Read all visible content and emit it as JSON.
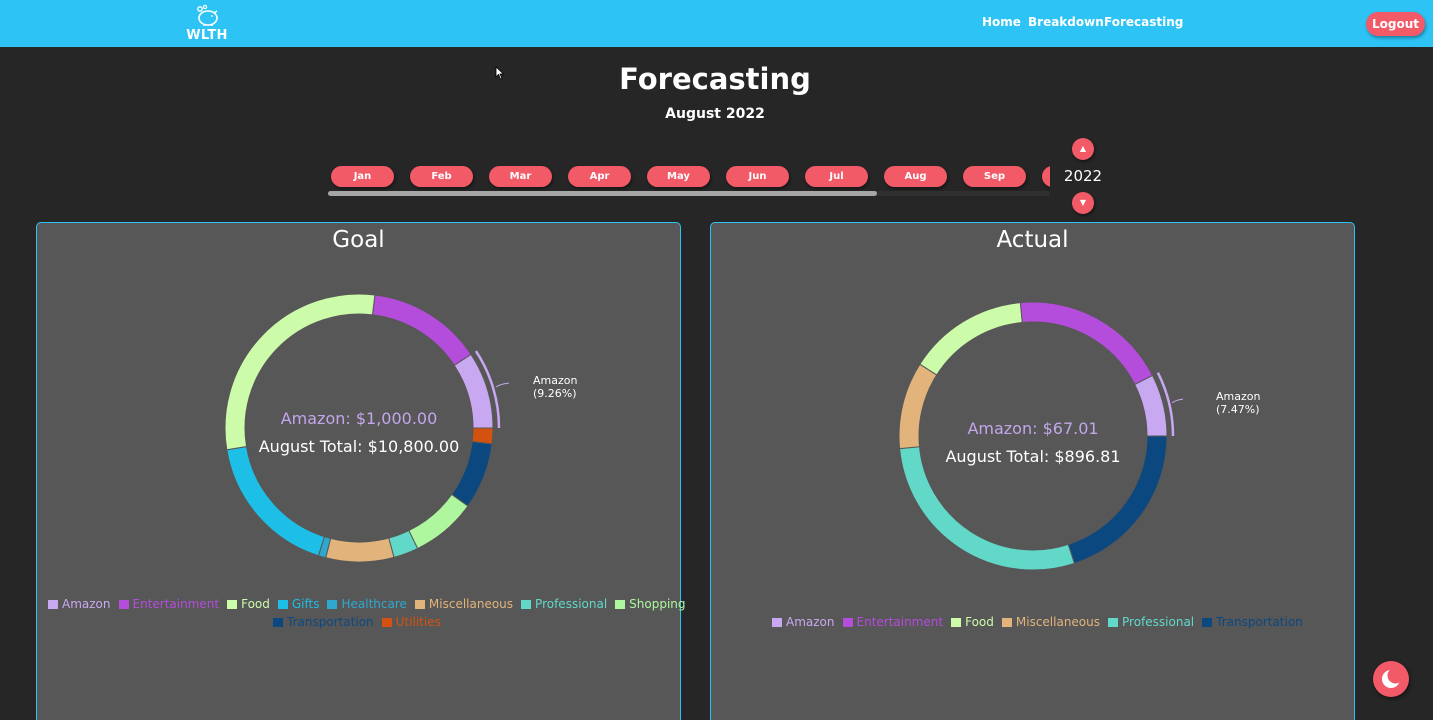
{
  "header": {
    "logo_text": "WLTH",
    "nav": [
      "Home",
      "Breakdown",
      "Forecasting"
    ],
    "logout_label": "Logout"
  },
  "page": {
    "title": "Forecasting",
    "subtitle": "August 2022"
  },
  "months": [
    "Jan",
    "Feb",
    "Mar",
    "Apr",
    "May",
    "Jun",
    "Jul",
    "Aug",
    "Sep"
  ],
  "year": {
    "value": "2022",
    "up_icon": "▲",
    "down_icon": "▼"
  },
  "month_scroll_fraction": 0.76,
  "colors": {
    "Amazon": "#c8a8f0",
    "Entertainment": "#b44cdc",
    "Food": "#ccfcaa",
    "Gifts": "#1ebfe6",
    "Healthcare": "#2fa8d0",
    "Miscellaneous": "#e2b47c",
    "Professional": "#62d8c8",
    "Shopping": "#aef79e",
    "Transportation": "#0c4880",
    "Utilities": "#d45210"
  },
  "goal": {
    "title": "Goal",
    "center_label": "Amazon: $1,000.00",
    "center_total": "August Total: $10,800.00",
    "callout_name": "Amazon",
    "callout_pct": "(9.26%)",
    "legend_row1": [
      "Amazon",
      "Entertainment",
      "Food",
      "Gifts",
      "Healthcare",
      "Miscellaneous",
      "Professional",
      "Shopping"
    ],
    "legend_row2": [
      "Transportation",
      "Utilities"
    ],
    "chart_data": {
      "type": "pie",
      "categories": [
        "Amazon",
        "Utilities",
        "Transportation",
        "Shopping",
        "Professional",
        "Miscellaneous",
        "Healthcare",
        "Gifts",
        "Food",
        "Entertainment"
      ],
      "values": [
        9.26,
        1.9,
        8.0,
        7.9,
        3.0,
        8.2,
        0.9,
        17.5,
        29.5,
        13.84
      ]
    }
  },
  "actual": {
    "title": "Actual",
    "center_label": "Amazon: $67.01",
    "center_total": "August Total: $896.81",
    "callout_name": "Amazon",
    "callout_pct": "(7.47%)",
    "legend_row1": [
      "Amazon",
      "Entertainment",
      "Food",
      "Miscellaneous",
      "Professional",
      "Transportation"
    ],
    "chart_data": {
      "type": "pie",
      "categories": [
        "Amazon",
        "Transportation",
        "Professional",
        "Miscellaneous",
        "Food",
        "Entertainment"
      ],
      "values": [
        7.47,
        20.0,
        28.5,
        10.5,
        14.5,
        19.03
      ]
    }
  }
}
